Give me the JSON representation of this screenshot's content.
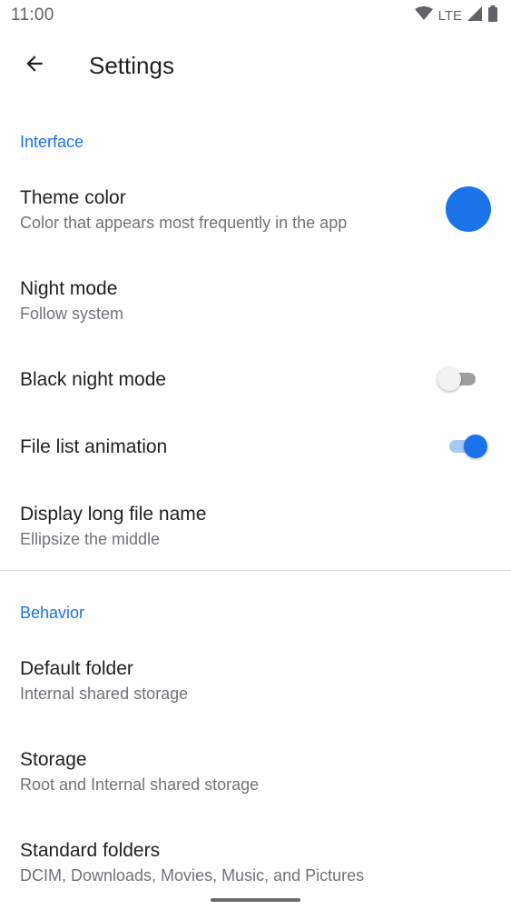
{
  "status_bar": {
    "time": "11:00",
    "network": "LTE",
    "icons": [
      "wifi-icon",
      "cell-signal-icon",
      "battery-icon"
    ]
  },
  "app_bar": {
    "back_icon": "arrow-back-icon",
    "title": "Settings"
  },
  "colors": {
    "accent": "#1a73e8",
    "text_primary": "#202124",
    "text_secondary": "#6f7378"
  },
  "sections": {
    "interface": {
      "header": "Interface",
      "theme_color": {
        "title": "Theme color",
        "summary": "Color that appears most frequently in the app",
        "swatch_color": "#1a73e8"
      },
      "night_mode": {
        "title": "Night mode",
        "summary": "Follow system"
      },
      "black_night_mode": {
        "title": "Black night mode",
        "enabled": false
      },
      "file_list_animation": {
        "title": "File list animation",
        "enabled": true
      },
      "long_file_name": {
        "title": "Display long file name",
        "summary": "Ellipsize the middle"
      }
    },
    "behavior": {
      "header": "Behavior",
      "default_folder": {
        "title": "Default folder",
        "summary": "Internal shared storage"
      },
      "storage": {
        "title": "Storage",
        "summary": "Root and Internal shared storage"
      },
      "standard_folders": {
        "title": "Standard folders",
        "summary": "DCIM, Downloads, Movies, Music, and Pictures"
      }
    }
  }
}
